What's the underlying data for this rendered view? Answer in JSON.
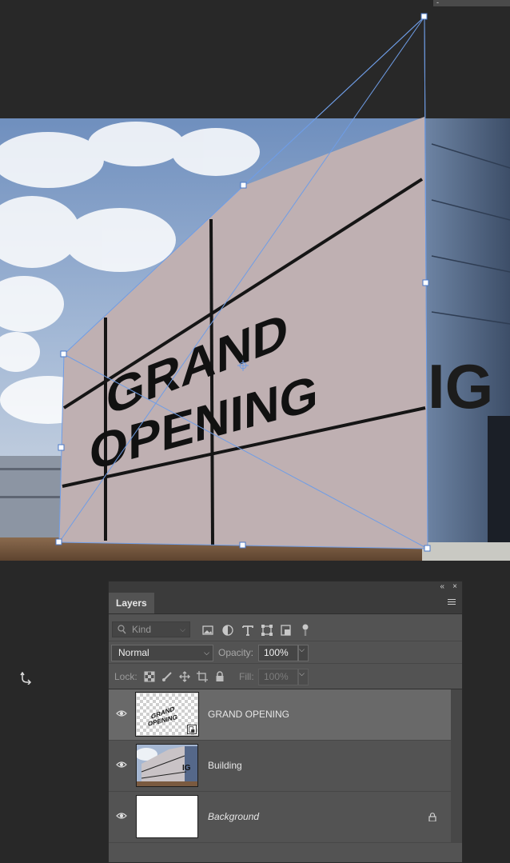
{
  "canvas": {
    "artwork_text_line1": "GRAND",
    "artwork_text_line2": "OPENING",
    "background_sign_fragment": "IG"
  },
  "layers_panel": {
    "tab_label": "Layers",
    "collapse_icon": "double-chevron-left-icon",
    "close_icon": "close-icon",
    "menu_icon": "hamburger-menu-icon",
    "filter": {
      "placeholder": "Kind",
      "filter_icons": [
        "pixel-layer-filter-icon",
        "adjustment-layer-filter-icon",
        "type-layer-filter-icon",
        "shape-layer-filter-icon",
        "smart-object-filter-icon",
        "filter-toggle-icon"
      ]
    },
    "blend_mode": "Normal",
    "opacity_label": "Opacity:",
    "opacity_value": "100%",
    "lock_label": "Lock:",
    "lock_icons": [
      "lock-transparent-pixels-icon",
      "lock-image-pixels-icon",
      "lock-position-icon",
      "lock-artboard-icon",
      "lock-all-icon"
    ],
    "fill_label": "Fill:",
    "fill_value": "100%",
    "layers": [
      {
        "name": "GRAND OPENING",
        "selected": true,
        "visible": true,
        "smart_object": true,
        "locked": false
      },
      {
        "name": "Building",
        "selected": false,
        "visible": true,
        "smart_object": false,
        "locked": false
      },
      {
        "name": "Background",
        "selected": false,
        "visible": true,
        "smart_object": false,
        "locked": true
      }
    ]
  },
  "colors": {
    "workspace": "#282828",
    "panel": "#535353",
    "selected_layer": "#696969",
    "transform_guide": "#6f9de6"
  }
}
